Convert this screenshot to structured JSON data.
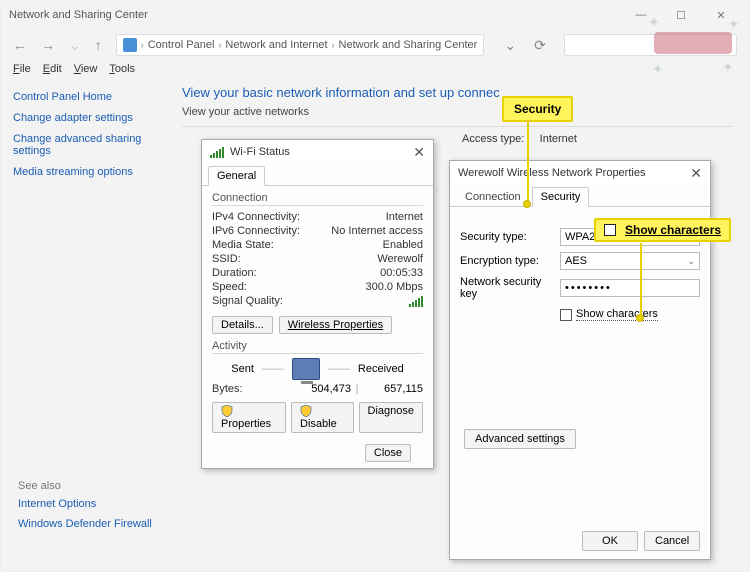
{
  "window": {
    "title": "Network and Sharing Center",
    "min": "—",
    "max": "☐",
    "close": "✕"
  },
  "nav": {
    "back": "←",
    "fwd": "→",
    "up": "↑",
    "refresh": "⟳",
    "dd": "⌄"
  },
  "breadcrumbs": [
    "Control Panel",
    "Network and Internet",
    "Network and Sharing Center"
  ],
  "menubar": [
    "File",
    "Edit",
    "View",
    "Tools"
  ],
  "side": {
    "home": "Control Panel Home",
    "items": [
      "Change adapter settings",
      "Change advanced sharing settings",
      "Media streaming options"
    ]
  },
  "main": {
    "heading": "View your basic network information and set up connec",
    "active": "View your active networks",
    "access_label": "Access type:",
    "access_value": "Internet"
  },
  "wifi": {
    "title": "Wi-Fi Status",
    "tab": "General",
    "sec_conn": "Connection",
    "rows": [
      {
        "k": "IPv4 Connectivity:",
        "v": "Internet"
      },
      {
        "k": "IPv6 Connectivity:",
        "v": "No Internet access"
      },
      {
        "k": "Media State:",
        "v": "Enabled"
      },
      {
        "k": "SSID:",
        "v": "Werewolf"
      },
      {
        "k": "Duration:",
        "v": "00:05:33"
      },
      {
        "k": "Speed:",
        "v": "300.0 Mbps"
      }
    ],
    "signal": "Signal Quality:",
    "btn_details": "Details...",
    "btn_wprops": "Wireless Properties",
    "sec_act": "Activity",
    "sent": "Sent",
    "recv": "Received",
    "bytes": "Bytes:",
    "sentv": "504,473",
    "recvv": "657,115",
    "btn_props": "Properties",
    "btn_disable": "Disable",
    "btn_diag": "Diagnose",
    "btn_close": "Close"
  },
  "prop": {
    "title": "Werewolf Wireless Network Properties",
    "tab_conn": "Connection",
    "tab_sec": "Security",
    "f1": "Security type:",
    "v1": "WPA2-Personal",
    "f2": "Encryption type:",
    "v2": "AES",
    "f3": "Network security key",
    "v3": "••••••••",
    "show": "Show characters",
    "adv": "Advanced settings",
    "ok": "OK",
    "cancel": "Cancel"
  },
  "callouts": {
    "sec": "Security",
    "show": "Show characters"
  },
  "seealso": {
    "title": "See also",
    "a": "Internet Options",
    "b": "Windows Defender Firewall"
  }
}
